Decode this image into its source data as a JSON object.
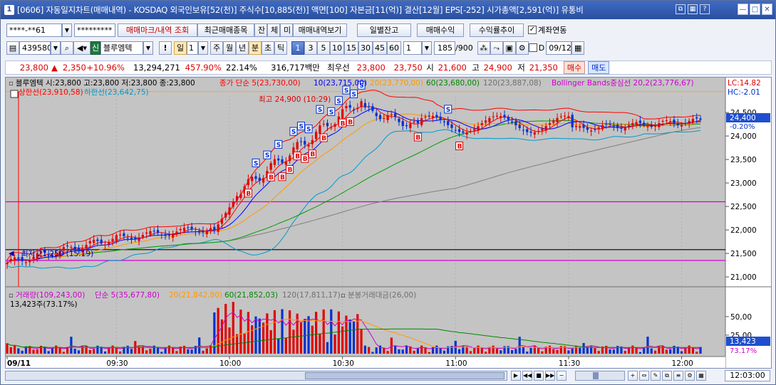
{
  "title": {
    "number": "1",
    "text": "[0606] 자동일지차트(매매내역) - KOSDAQ 외국인보유[52(천)] 주식수[10,885(천)] 액면[100] 자본금[11(억)] 결산[12월] EPS[-252] 시가총액[2,591(억)] 유통비"
  },
  "toolbar1": {
    "account": "****-**61",
    "password": "*********",
    "buttons": [
      "매매마크/내역 조회",
      "최근매매종목",
      "잔",
      "체",
      "미",
      "매매내역보기"
    ],
    "right_buttons": [
      "일별잔고",
      "매매수익",
      "수익률추이"
    ],
    "checkbox_label": "계좌연동"
  },
  "toolbar2": {
    "code": "439580",
    "stock_badge": "신",
    "stock_name": "블루엠텍",
    "period_selected": "일",
    "period_num": "1",
    "periods": [
      "주",
      "월",
      "년",
      "분",
      "초",
      "틱"
    ],
    "minute_options": [
      "1",
      "3",
      "5",
      "10",
      "15",
      "30",
      "45",
      "60"
    ],
    "count_value": "1",
    "bar_count": "185",
    "bar_total": "/900",
    "d_label": "D",
    "date_value": "09/12"
  },
  "pricebar": {
    "price": "23,800",
    "change": "2,350",
    "change_pct": "+10.96%",
    "volume": "13,294,271",
    "vol_ratio": "457.90%",
    "turnover": "22.14%",
    "amount": "316,717백만",
    "best_label": "최우선",
    "ask": "23,800",
    "bid": "23,750",
    "open_label": "시",
    "open": "21,600",
    "high_label": "고",
    "high": "24,900",
    "low_label": "저",
    "low": "21,350",
    "buy_btn": "매수",
    "sell_btn": "매도"
  },
  "legend": {
    "price_info": "블루엠텍 시:23,800 고:23,800 저:23,800 종:23,800",
    "ma_label": "종가 단순 5(23,730,00)",
    "ma10": "10(23,715,00)",
    "ma20": "20(23,770,00)",
    "ma60": "60(23,680,00)",
    "ma120": "120(23,887,08)",
    "bb": "Bollinger Bands중심선 20,2(23,776,67)",
    "bb_upper": "상한선(23,910,58)",
    "bb_lower": "하한선(23,642,75)",
    "lc": "LC:14.82",
    "hc": "HC:-2.01",
    "high_marker": "최고 24,900 (10:29)",
    "low_marker": "최저 21,250 (15:19)",
    "vol_label": "거래량(109,243,00)",
    "vol_ma5": "단순 5(35,677,80)",
    "vol_ma20": "20(21,842,80)",
    "vol_ma60": "60(21,852,03)",
    "vol_ma120": "120(17,811,17)",
    "vol_amount": "분봉거래대금(26,00)",
    "vol_info": "13,423주(73.17%)"
  },
  "price_axis": [
    "24,500",
    "24,000",
    "23,500",
    "23,000",
    "22,500",
    "22,000",
    "21,500",
    "21,000"
  ],
  "current_price_tag": "24,400",
  "current_pct_tag": "-0.20%",
  "vol_axis": [
    "50,00",
    "25,00"
  ],
  "vol_tag": "13,423",
  "vol_pct_tag": "73.17%",
  "time_axis": [
    "09/11",
    "09:30",
    "10:00",
    "10:30",
    "11:00",
    "11:30",
    "12:00"
  ],
  "current_time": "12:03:00",
  "colors": {
    "up": "#e00000",
    "down": "#0030d0",
    "ma5": "#ff0000",
    "ma10": "#0000ff",
    "ma20": "#ff9900",
    "ma60": "#00a000",
    "ma120": "#808080",
    "bb": "#cc00cc"
  }
}
